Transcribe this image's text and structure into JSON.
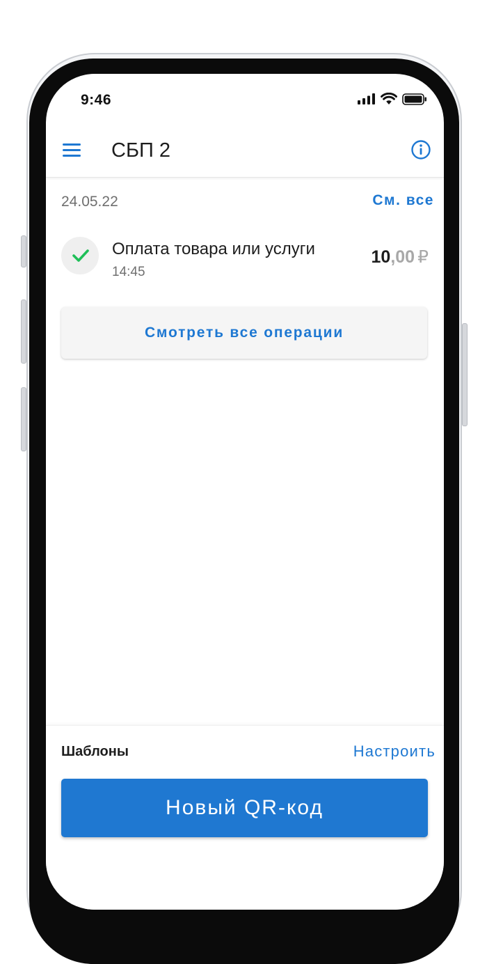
{
  "status_bar": {
    "time": "9:46",
    "icons": [
      "signal-icon",
      "wifi-icon",
      "battery-icon"
    ]
  },
  "header": {
    "title": "СБП 2",
    "menu_icon": "hamburger-menu-icon",
    "info_icon": "info-icon"
  },
  "operations": {
    "date": "24.05.22",
    "see_all_label": "См. все",
    "items": [
      {
        "status_icon": "check-icon",
        "title": "Оплата товара или услуги",
        "time": "14:45",
        "amount_integer": "10",
        "amount_fraction": ",00",
        "currency": "₽"
      }
    ],
    "view_all_button": "Смотреть все операции"
  },
  "templates": {
    "title": "Шаблоны",
    "configure_label": "Настроить",
    "new_qr_button": "Новый QR-код"
  },
  "colors": {
    "accent": "#1e78d2",
    "success": "#1fbf58",
    "muted_text": "#6f6f6f"
  }
}
